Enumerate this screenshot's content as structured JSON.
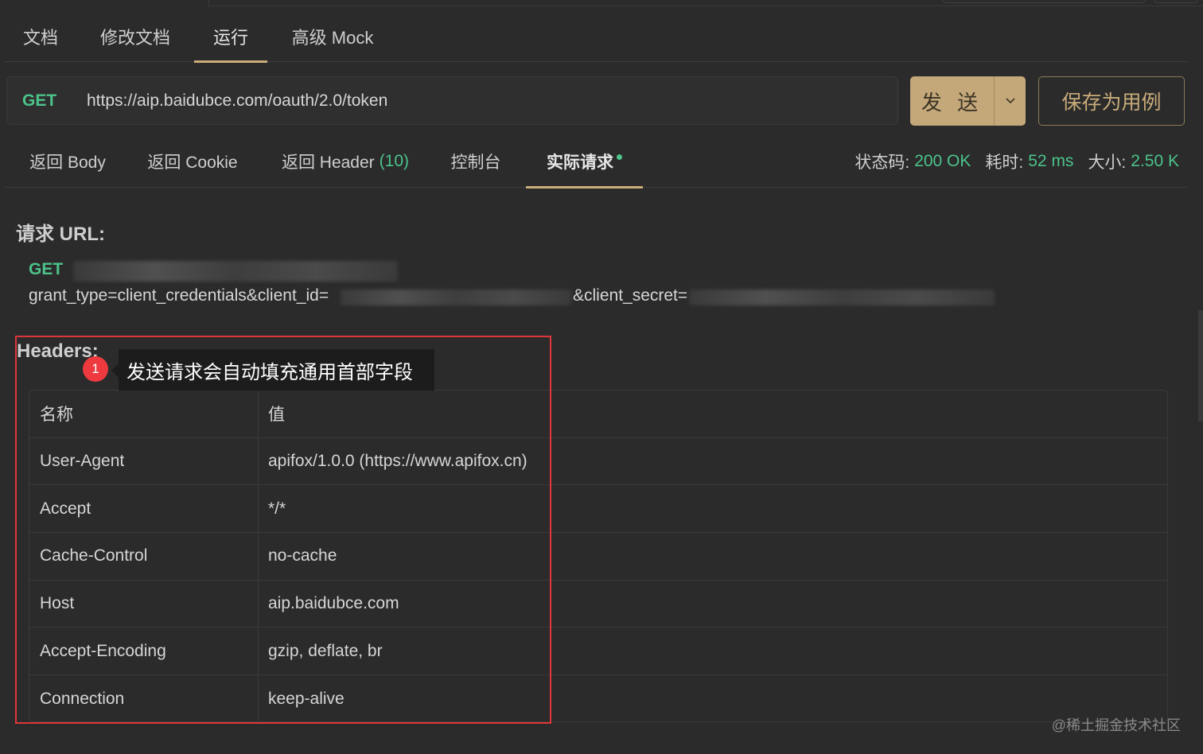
{
  "main_tabs": [
    "文档",
    "修改文档",
    "运行",
    "高级 Mock"
  ],
  "request": {
    "method": "GET",
    "url": "https://aip.baidubce.com/oauth/2.0/token",
    "send_label": "发 送",
    "save_label": "保存为用例"
  },
  "response_tabs": {
    "body": "返回 Body",
    "cookie": "返回 Cookie",
    "header": "返回 Header",
    "header_count": "(10)",
    "console": "控制台",
    "actual": "实际请求"
  },
  "stats": {
    "status_label": "状态码:",
    "status_value": "200 OK",
    "time_label": "耗时:",
    "time_value": "52 ms",
    "size_label": "大小:",
    "size_value": "2.50 K"
  },
  "actual_request": {
    "url_title": "请求 URL:",
    "method": "GET",
    "query_prefix": "grant_type=client_credentials&client_id=",
    "query_secret": "&client_secret=",
    "headers_title": "Headers:"
  },
  "headers_table": {
    "col_name": "名称",
    "col_value": "值",
    "rows": [
      {
        "name": "User-Agent",
        "value": "apifox/1.0.0 (https://www.apifox.cn)"
      },
      {
        "name": "Accept",
        "value": "*/*"
      },
      {
        "name": "Cache-Control",
        "value": "no-cache"
      },
      {
        "name": "Host",
        "value": "aip.baidubce.com"
      },
      {
        "name": "Accept-Encoding",
        "value": "gzip, deflate, br"
      },
      {
        "name": "Connection",
        "value": "keep-alive"
      }
    ]
  },
  "annotation": {
    "badge": "1",
    "text": "发送请求会自动填充通用首部字段"
  },
  "watermark": "@稀土掘金技术社区",
  "colors": {
    "accent": "#c9ac7a",
    "green": "#4cc38a",
    "highlight": "#e0363a"
  }
}
